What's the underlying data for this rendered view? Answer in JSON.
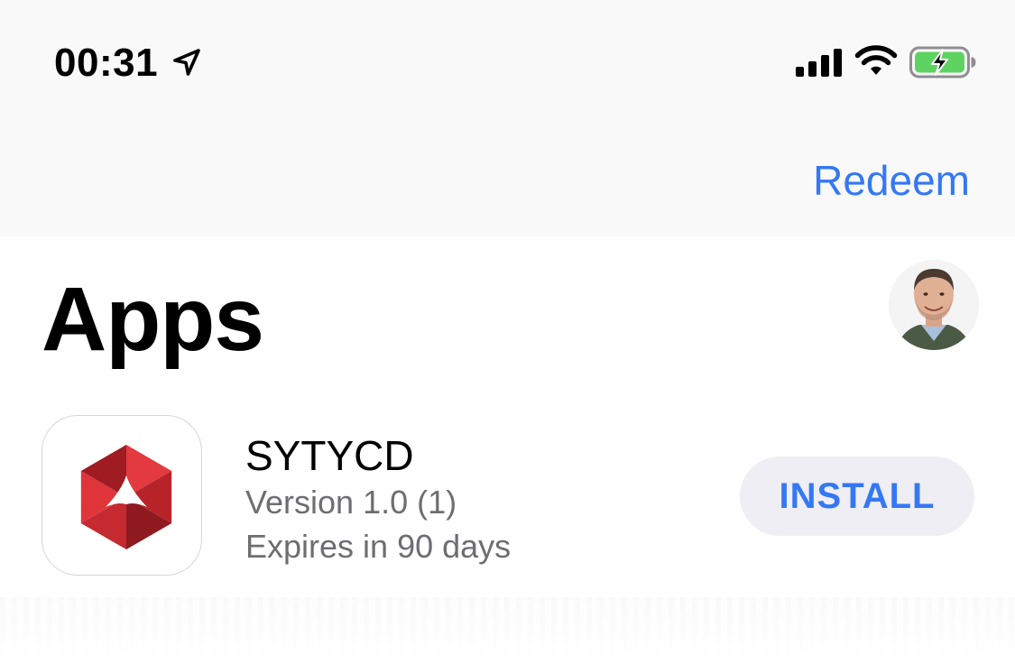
{
  "status_bar": {
    "time": "00:31",
    "icons": [
      "location-arrow-icon",
      "cellular-signal-icon",
      "wifi-icon",
      "battery-charging-icon"
    ]
  },
  "nav": {
    "redeem_label": "Redeem"
  },
  "page": {
    "title": "Apps",
    "avatar_icon": "user-avatar"
  },
  "apps": [
    {
      "name": "SYTYCD",
      "version": "Version 1.0 (1)",
      "expiry": "Expires in 90 days",
      "action_label": "INSTALL",
      "icon": "red-hexagon-logo"
    }
  ],
  "colors": {
    "accent": "#3478f6",
    "secondary_text": "#6d6d72",
    "button_bg": "#eeeef4",
    "battery_green": "#5fd361",
    "logo_red": "#d32f2f"
  }
}
